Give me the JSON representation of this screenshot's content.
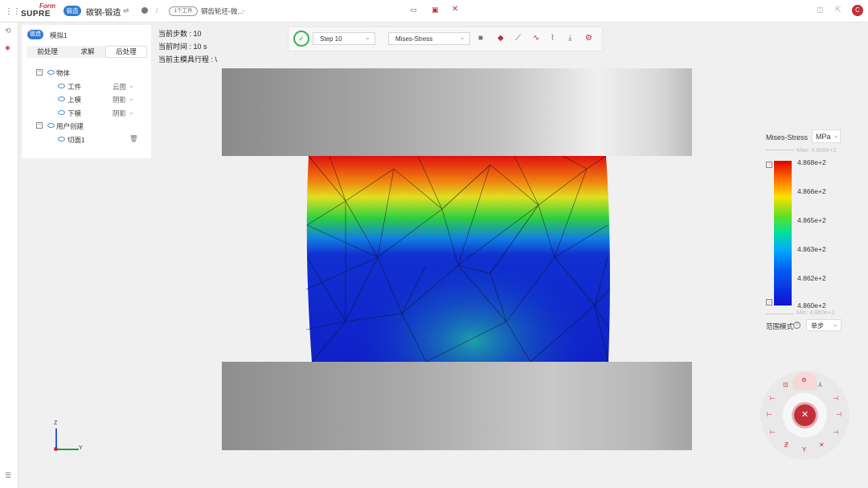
{
  "app": {
    "logo_top": "Form",
    "logo_bottom": "SUPRE",
    "mode_badge": "锻造",
    "title": "碳钢-锻造",
    "sub_tag": "1个工件",
    "file_name": "钢齿轮坯-微...",
    "user_initial": "C"
  },
  "panel": {
    "badge": "锻造",
    "model": "模拟1",
    "tabs": [
      "前处理",
      "求解",
      "后处理"
    ],
    "active_tab": 2
  },
  "tree": {
    "objects": "物体",
    "workpiece": "工件",
    "workpiece_mode": "云图",
    "upper_die": "上模",
    "upper_mode": "阴影",
    "lower_die": "下模",
    "lower_mode": "阴影",
    "user_created": "用户创建",
    "section": "切面1"
  },
  "info": {
    "step": "当前步数 : 10",
    "time": "当前时间 : 10 s",
    "stroke": "当前主模具行程 : \\"
  },
  "toolbar": {
    "step_select": "Step 10",
    "var_select": "Mises-Stress"
  },
  "legend": {
    "title": "Mises-Stress",
    "unit": "MPa",
    "max_label": "Max: 4.868e+2",
    "min_label": "Min: 4.860e+2",
    "ticks": [
      "4.868e+2",
      "4.866e+2",
      "4.865e+2",
      "4.863e+2",
      "4.862e+2",
      "4.860e+2"
    ],
    "range_mode_label": "范围模式",
    "range_mode_value": "单步"
  },
  "axes": {
    "z": "Z",
    "y": "Y"
  },
  "colors": {
    "accent": "#c0303a",
    "brand_blue": "#2f7ad6",
    "ok_green": "#3ab44a"
  }
}
